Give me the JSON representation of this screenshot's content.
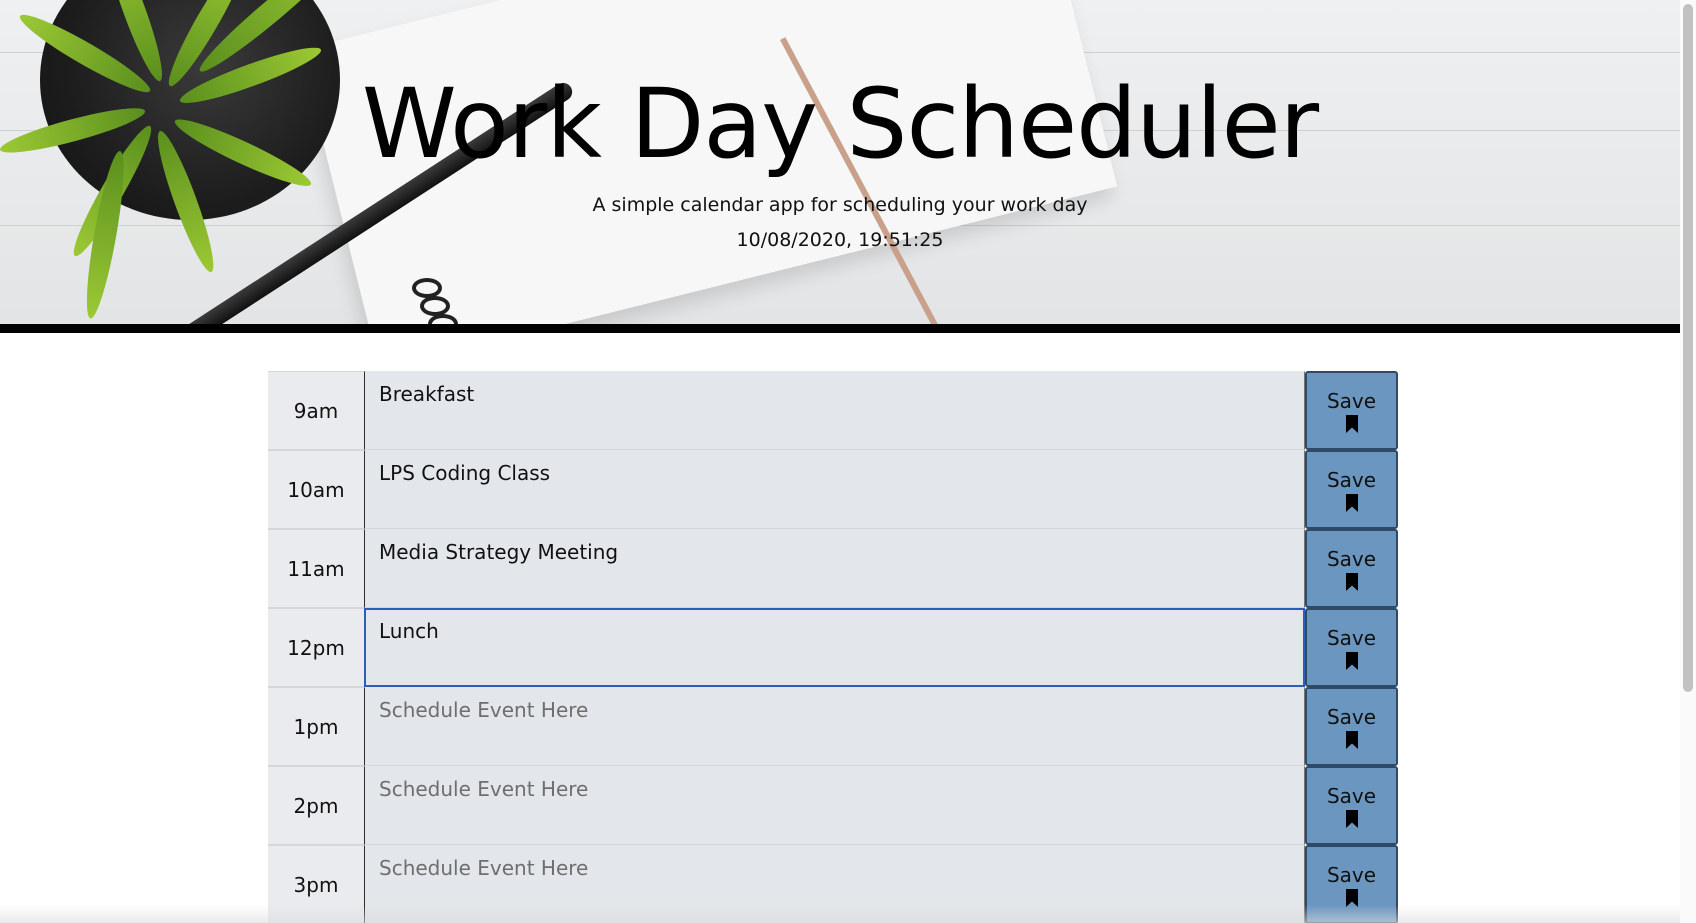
{
  "header": {
    "title": "Work Day Scheduler",
    "subtitle": "A simple calendar app for scheduling your work day",
    "datetime": "10/08/2020, 19:51:25"
  },
  "schedule": {
    "save_label": "Save",
    "placeholder": "Schedule Event Here",
    "rows": [
      {
        "hour": "9am",
        "event": "Breakfast"
      },
      {
        "hour": "10am",
        "event": "LPS Coding Class"
      },
      {
        "hour": "11am",
        "event": "Media Strategy Meeting"
      },
      {
        "hour": "12pm",
        "event": "Lunch"
      },
      {
        "hour": "1pm",
        "event": ""
      },
      {
        "hour": "2pm",
        "event": ""
      },
      {
        "hour": "3pm",
        "event": ""
      }
    ]
  },
  "icons": {
    "save": "bookmark-icon"
  },
  "colors": {
    "save_button": "#6b96c0",
    "event_bg": "#e3e6ea",
    "focus_border": "#2b5dbb"
  }
}
